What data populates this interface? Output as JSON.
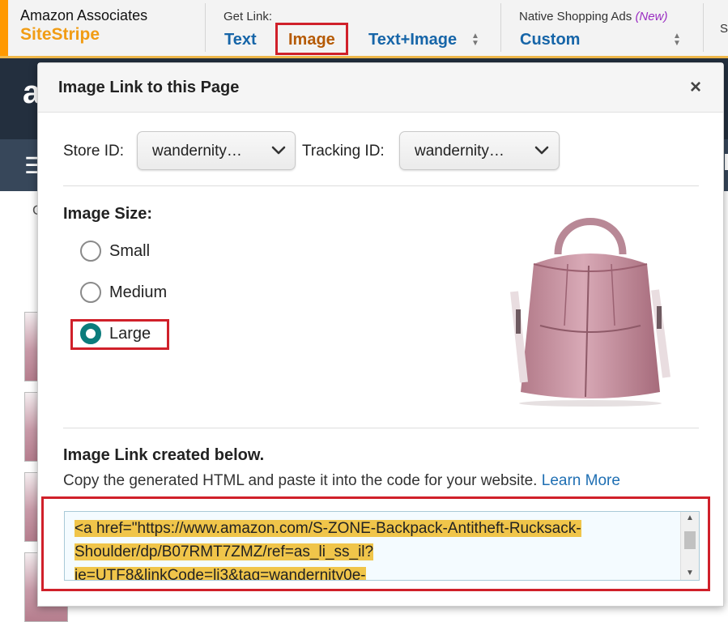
{
  "sitestripe": {
    "brand_line1": "Amazon Associates",
    "brand_line2": "SiteStripe",
    "get_link_label": "Get Link:",
    "links": [
      "Text",
      "Image",
      "Text+Image"
    ],
    "selected_link": "Image",
    "native_ads_label": "Native Shopping Ads",
    "native_ads_new": "(New)",
    "native_ads_value": "Custom",
    "cut_off_text": "S"
  },
  "background_page": {
    "logo_letter": "a",
    "menu_icon": "☰",
    "cut_letter": "G"
  },
  "popup": {
    "title": "Image Link to this Page",
    "close_label": "×",
    "store_id_label": "Store ID:",
    "store_id_value": "wandernity…",
    "tracking_id_label": "Tracking ID:",
    "tracking_id_value": "wandernity…",
    "image_size_label": "Image Size:",
    "sizes": [
      "Small",
      "Medium",
      "Large"
    ],
    "selected_size": "Large",
    "product_image_icon": "backpack-icon",
    "link_created_label": "Image Link created below.",
    "copy_instructions": "Copy the generated HTML and paste it into the code for your website.",
    "learn_more_label": "Learn More",
    "code_lines": [
      "<a href=\"https://www.amazon.com/S-ZONE-Backpack-Antitheft-Rucksack-",
      "Shoulder/dp/B07RMT7ZMZ/ref=as_li_ss_il?",
      "ie=UTF8&linkCode=li3&tag=wandernity0e-"
    ]
  },
  "colors": {
    "accent_orange": "#ff9900",
    "highlight_red": "#d0202a",
    "link_blue": "#1665a8",
    "selected_teal": "#0b7c7c",
    "code_highlight": "#f0c54a"
  }
}
